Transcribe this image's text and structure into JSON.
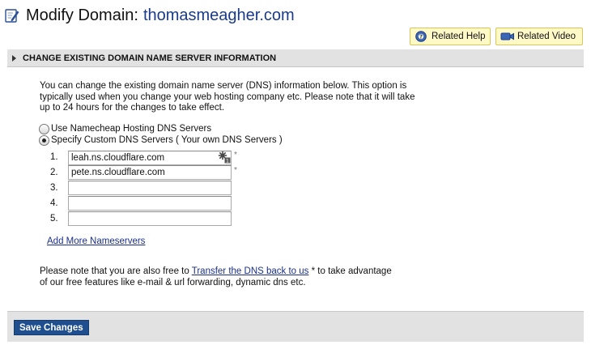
{
  "header": {
    "title_prefix": "Modify Domain:",
    "domain": "thomasmeagher.com",
    "icon": "edit-pencil-icon"
  },
  "help_buttons": {
    "related_help": "Related Help",
    "related_video": "Related Video"
  },
  "section": {
    "title": "CHANGE EXISTING DOMAIN NAME SERVER INFORMATION"
  },
  "intro_text": "You can change the existing domain name server (DNS) information below. This option is typically used when you change your web hosting company etc. Please note that it will take up to 24 hours for the changes to take effect.",
  "dns_options": {
    "hosting": {
      "label": "Use Namecheap Hosting DNS Servers",
      "selected": false
    },
    "custom": {
      "label": "Specify Custom DNS Servers ( Your own DNS Servers )",
      "selected": true
    }
  },
  "nameservers": [
    {
      "num": "1.",
      "value": "leah.ns.cloudflare.com",
      "required": "*"
    },
    {
      "num": "2.",
      "value": "pete.ns.cloudflare.com",
      "required": "*"
    },
    {
      "num": "3.",
      "value": ""
    },
    {
      "num": "4.",
      "value": ""
    },
    {
      "num": "5.",
      "value": ""
    }
  ],
  "add_more_label": "Add More Nameservers",
  "note": {
    "before": "Please note that you are also free to ",
    "link": "Transfer the DNS back to us",
    "after": " * to take advantage of our free features like e-mail & url forwarding, dynamic dns etc."
  },
  "footer": {
    "save_label": "Save Changes"
  },
  "colors": {
    "accent_link": "#1a2f8a",
    "domain_text": "#1a3a8a",
    "save_button": "#1f4f8f",
    "help_button_bg": "#fff9c8",
    "section_bar": "#e2e2e2"
  }
}
